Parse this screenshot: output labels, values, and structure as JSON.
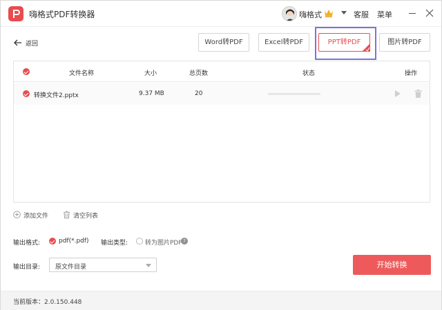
{
  "app": {
    "title": "嗨格式PDF转换器"
  },
  "titlebar": {
    "user_name": "嗨格式",
    "service_label": "客服",
    "menu_label": "菜单"
  },
  "toolbar": {
    "back_label": "返回",
    "tabs": [
      {
        "label": "Word转PDF",
        "active": false
      },
      {
        "label": "Excel转PDF",
        "active": false
      },
      {
        "label": "PPT转PDF",
        "active": true
      },
      {
        "label": "图片转PDF",
        "active": false
      }
    ]
  },
  "table": {
    "columns": {
      "name": "文件名称",
      "size": "大小",
      "pages": "总页数",
      "status": "状态",
      "actions": "操作"
    },
    "rows": [
      {
        "name": "转换文件2.pptx",
        "size": "9.37 MB",
        "pages": "20",
        "progress": 0
      }
    ]
  },
  "actions": {
    "add_file": "添加文件",
    "clear_list": "清空列表"
  },
  "options": {
    "format_label": "输出格式:",
    "format_value": "pdf(*.pdf)",
    "type_label": "输出类型:",
    "type_value": "转为图片PDF",
    "dir_label": "输出目录:",
    "dir_value": "原文件目录"
  },
  "start_button": "开始转换",
  "footer": {
    "version": "当前版本：2.0.150.448"
  },
  "colors": {
    "accent": "#e84c4f",
    "highlight_box": "#7b73d6"
  },
  "icons": [
    "logo-icon",
    "avatar",
    "crown-icon",
    "chevron-down-icon",
    "minimize-icon",
    "close-icon",
    "back-arrow-icon",
    "checked-circle-icon",
    "play-icon",
    "trash-icon",
    "add-circle-icon",
    "help-icon"
  ]
}
